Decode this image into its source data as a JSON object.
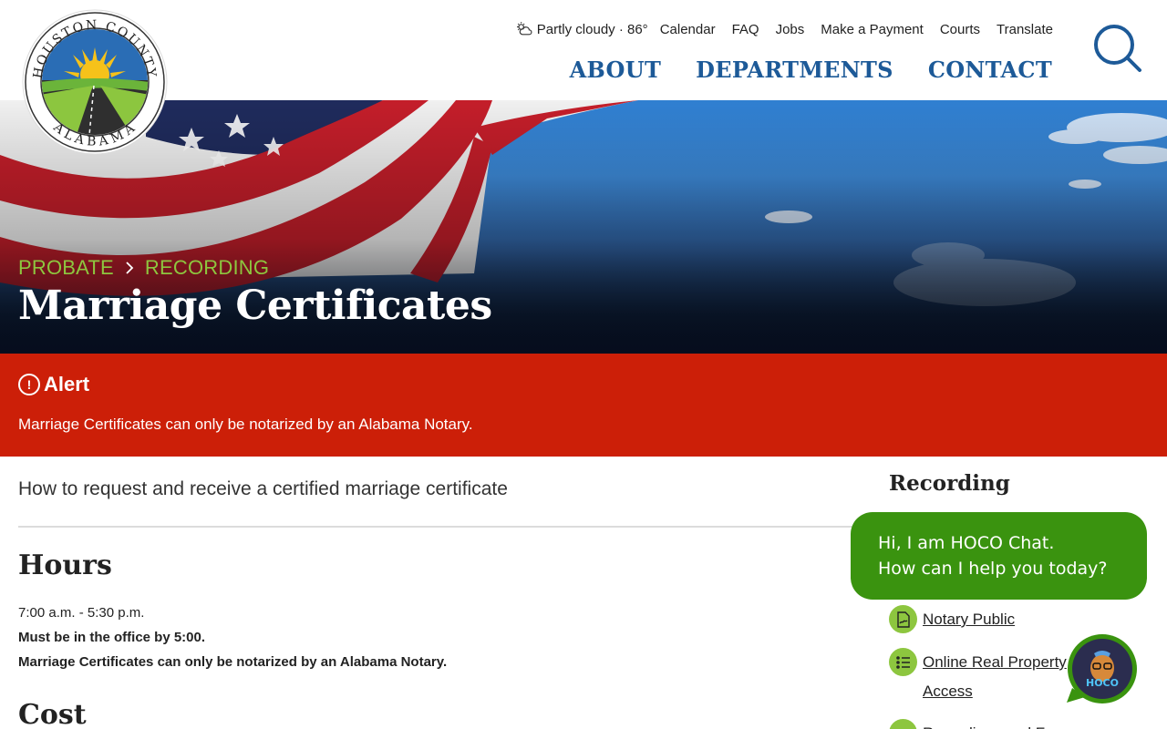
{
  "header": {
    "logo_text_top": "HOUSTON COUNTY",
    "logo_text_bottom": "ALABAMA",
    "weather": "Partly cloudy · 86°",
    "utility_links": [
      "Calendar",
      "FAQ",
      "Jobs",
      "Make a Payment",
      "Courts",
      "Translate"
    ],
    "main_nav": [
      "ABOUT",
      "DEPARTMENTS",
      "CONTACT"
    ]
  },
  "hero": {
    "breadcrumb": [
      "PROBATE",
      "RECORDING"
    ],
    "title": "Marriage Certificates"
  },
  "alert": {
    "heading": "Alert",
    "icon_glyph": "!",
    "message": "Marriage Certificates can only be notarized by an Alabama Notary."
  },
  "main": {
    "intro": "How to request and receive a certified marriage certificate",
    "hours_heading": "Hours",
    "hours": [
      "7:00 a.m. - 5:30 p.m.",
      "Must be in the office by 5:00.",
      "Marriage Certificates can only be notarized by an Alabama Notary."
    ],
    "cost_heading": "Cost"
  },
  "sidebar": {
    "heading": "Recording",
    "items": [
      {
        "label": "Notary Public",
        "icon": "signature-icon"
      },
      {
        "label": "Online Real Property Access",
        "icon": "list-icon"
      },
      {
        "label": "Recordings and Fees",
        "icon": "dollar-icon"
      }
    ]
  },
  "chat": {
    "greeting_line1": "Hi, I am HOCO Chat.",
    "greeting_line2": "How can I help you today?",
    "launcher_label": "HOCO"
  },
  "colors": {
    "nav_blue": "#1d5a98",
    "accent_green": "#8dc63f",
    "alert_red": "#cc1f08",
    "chat_green": "#3a930f"
  }
}
